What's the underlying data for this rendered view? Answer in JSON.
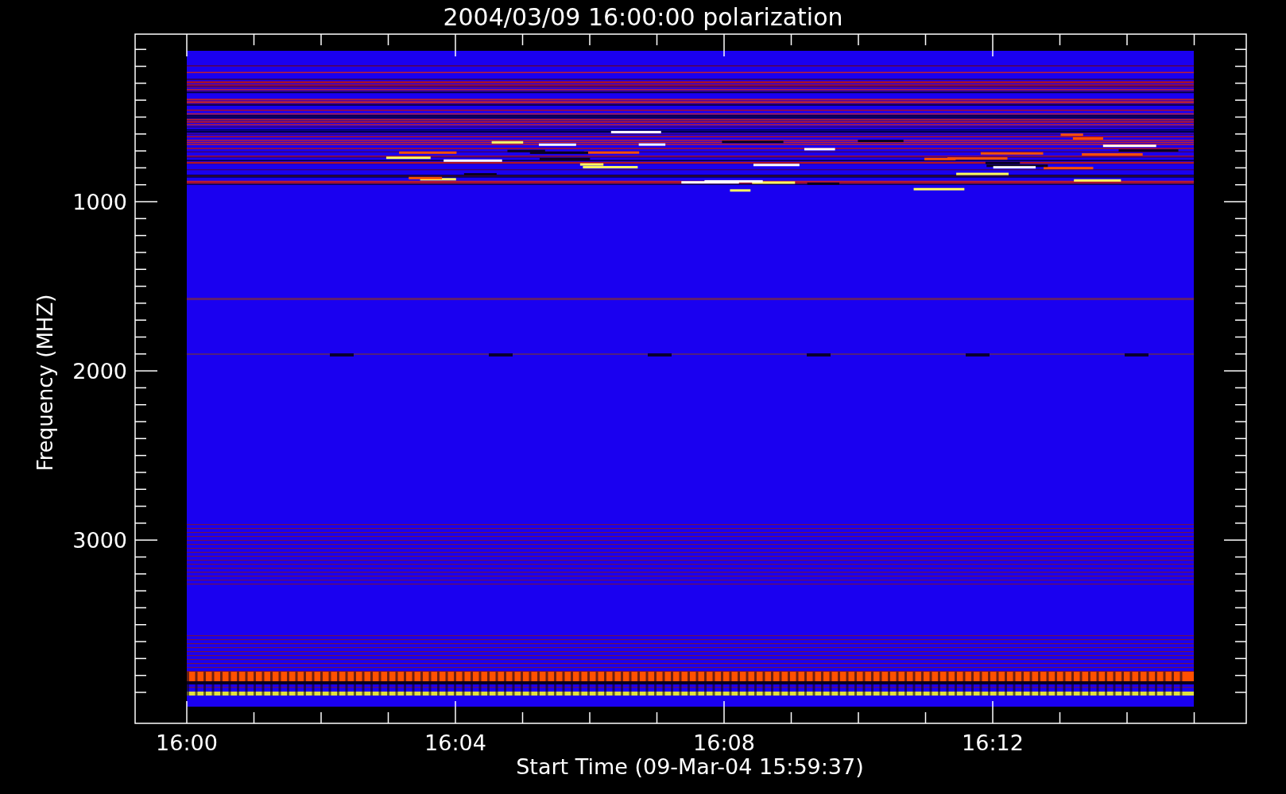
{
  "plot": {
    "title": "2004/03/09 16:00:00 polarization",
    "ylabel": "Frequency (MHZ)",
    "xlabel": "Start Time (09-Mar-04 15:59:37)",
    "yticks": [
      "1000",
      "2000",
      "3000"
    ],
    "xticks": [
      "16:00",
      "16:04",
      "16:08",
      "16:12"
    ]
  }
}
